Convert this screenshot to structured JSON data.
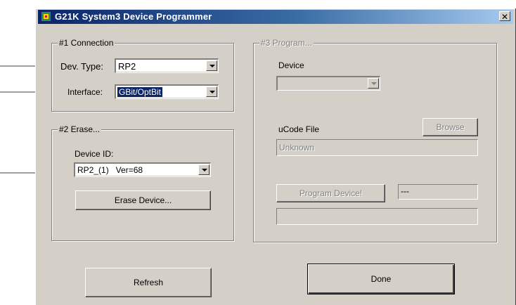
{
  "window": {
    "title": "G21K  System3 Device Programmer",
    "close_glyph": "✕",
    "icon": "programmer-chip-icon"
  },
  "connection": {
    "legend": "#1 Connection",
    "dev_type_label": "Dev. Type:",
    "dev_type_value": "RP2",
    "interface_label": "Interface:",
    "interface_value": "GBit/OptBit"
  },
  "erase": {
    "legend": "#2 Erase...",
    "device_id_label": "Device ID:",
    "device_id_value": "RP2_(1)   Ver=68",
    "erase_button": "Erase Device..."
  },
  "program": {
    "legend": "#3 Program...",
    "device_label": "Device",
    "device_value": "",
    "ucode_label": "uCode File",
    "browse_button": "Browse",
    "ucode_value": "Unknown",
    "program_button": "Program Device!",
    "status_value": "---",
    "progress_value": ""
  },
  "footer": {
    "refresh_button": "Refresh",
    "done_button": "Done"
  },
  "colors": {
    "face": "#d4d0c8",
    "title_start": "#0a246a",
    "title_end": "#a6caf0",
    "selection": "#0a246a"
  }
}
